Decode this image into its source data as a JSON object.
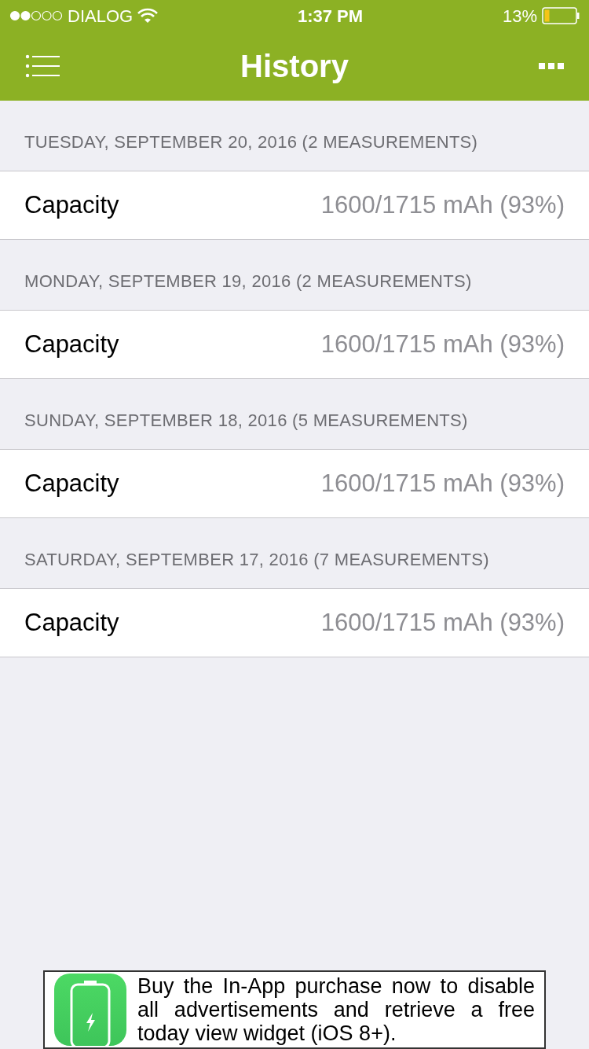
{
  "status_bar": {
    "carrier": "DIALOG",
    "time": "1:37 PM",
    "battery": "13%"
  },
  "nav": {
    "title": "History"
  },
  "sections": [
    {
      "header": "TUESDAY, SEPTEMBER 20, 2016 (2 MEASUREMENTS)",
      "rows": [
        {
          "label": "Capacity",
          "value": "1600/1715 mAh (93%)"
        }
      ]
    },
    {
      "header": "MONDAY, SEPTEMBER 19, 2016 (2 MEASUREMENTS)",
      "rows": [
        {
          "label": "Capacity",
          "value": "1600/1715 mAh (93%)"
        }
      ]
    },
    {
      "header": "SUNDAY, SEPTEMBER 18, 2016 (5 MEASUREMENTS)",
      "rows": [
        {
          "label": "Capacity",
          "value": "1600/1715 mAh (93%)"
        }
      ]
    },
    {
      "header": "SATURDAY, SEPTEMBER 17, 2016 (7 MEASUREMENTS)",
      "rows": [
        {
          "label": "Capacity",
          "value": "1600/1715 mAh (93%)"
        }
      ]
    }
  ],
  "ad": {
    "text": "Buy the In-App purchase now to disable all advertisements and retrieve a free today view widget (iOS 8+)."
  }
}
